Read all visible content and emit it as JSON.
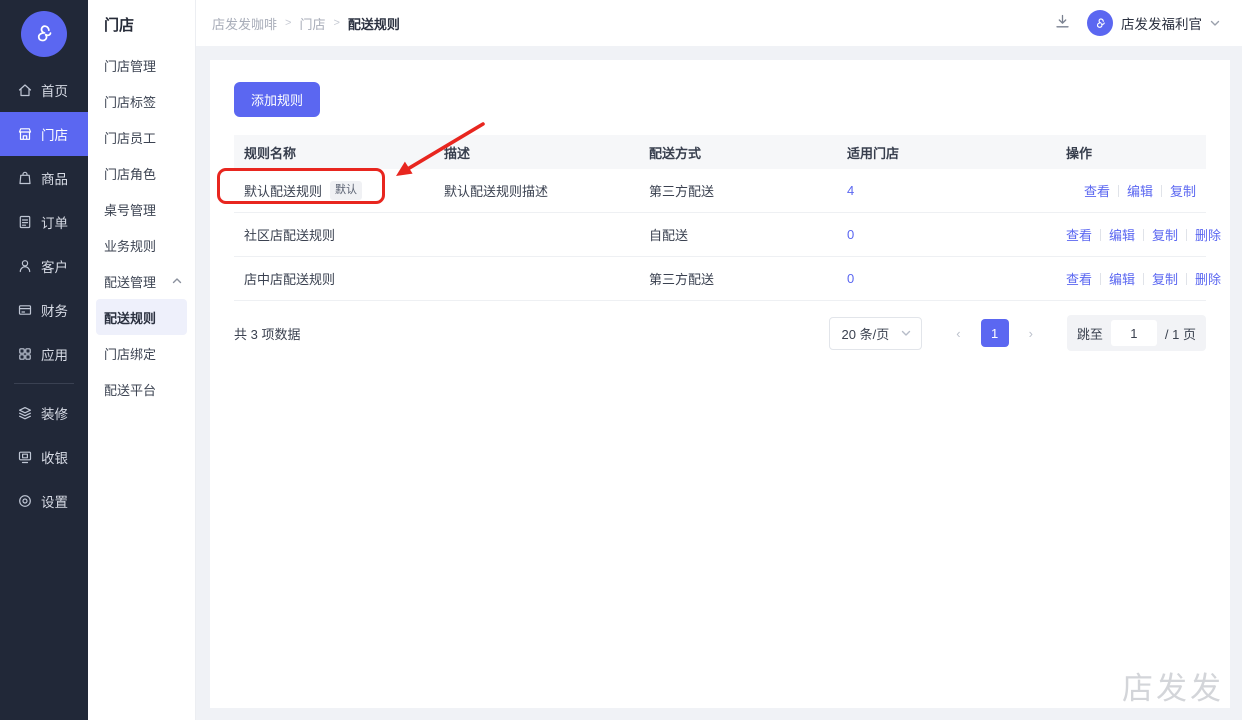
{
  "sidebar": {
    "items": [
      {
        "label": "首页",
        "icon": "home-icon"
      },
      {
        "label": "门店",
        "icon": "store-icon",
        "active": true
      },
      {
        "label": "商品",
        "icon": "goods-icon"
      },
      {
        "label": "订单",
        "icon": "orders-icon"
      },
      {
        "label": "客户",
        "icon": "customers-icon"
      },
      {
        "label": "财务",
        "icon": "finance-icon"
      },
      {
        "label": "应用",
        "icon": "apps-icon"
      },
      {
        "label": "装修",
        "icon": "decorate-icon"
      },
      {
        "label": "收银",
        "icon": "cashier-icon"
      },
      {
        "label": "设置",
        "icon": "settings-icon"
      }
    ]
  },
  "submenu": {
    "title": "门店",
    "items": [
      "门店管理",
      "门店标签",
      "门店员工",
      "门店角色",
      "桌号管理",
      "业务规则"
    ],
    "group": {
      "label": "配送管理",
      "expanded": true,
      "children": [
        "配送规则",
        "门店绑定",
        "配送平台"
      ],
      "active_child": "配送规则"
    }
  },
  "topbar": {
    "breadcrumb": [
      "店发发咖啡",
      "门店",
      "配送规则"
    ],
    "separator": ">",
    "user_name": "店发发福利官"
  },
  "content": {
    "add_button": "添加规则",
    "table": {
      "headers": [
        "规则名称",
        "描述",
        "配送方式",
        "适用门店",
        "操作"
      ],
      "rows": [
        {
          "name": "默认配送规则",
          "badge": "默认",
          "desc": "默认配送规则描述",
          "method": "第三方配送",
          "stores": "4"
        },
        {
          "name": "社区店配送规则",
          "desc": "",
          "method": "自配送",
          "stores": "0"
        },
        {
          "name": "店中店配送规则",
          "desc": "",
          "method": "第三方配送",
          "stores": "0"
        }
      ],
      "actions": {
        "view": "查看",
        "edit": "编辑",
        "copy": "复制",
        "delete": "删除"
      }
    },
    "pagination": {
      "total": "共 3 项数据",
      "page_size": "20 条/页",
      "current_page": "1",
      "jump_label": "跳至",
      "jump_value": "1",
      "page_suffix": "/ 1 页"
    },
    "watermark": "店发发"
  },
  "colors": {
    "accent": "#5b67f1",
    "sidebar_bg": "#212838",
    "active_submenu_bg": "#eef0fb",
    "annotation_red": "#e8261f",
    "link": "#5b67f1"
  }
}
